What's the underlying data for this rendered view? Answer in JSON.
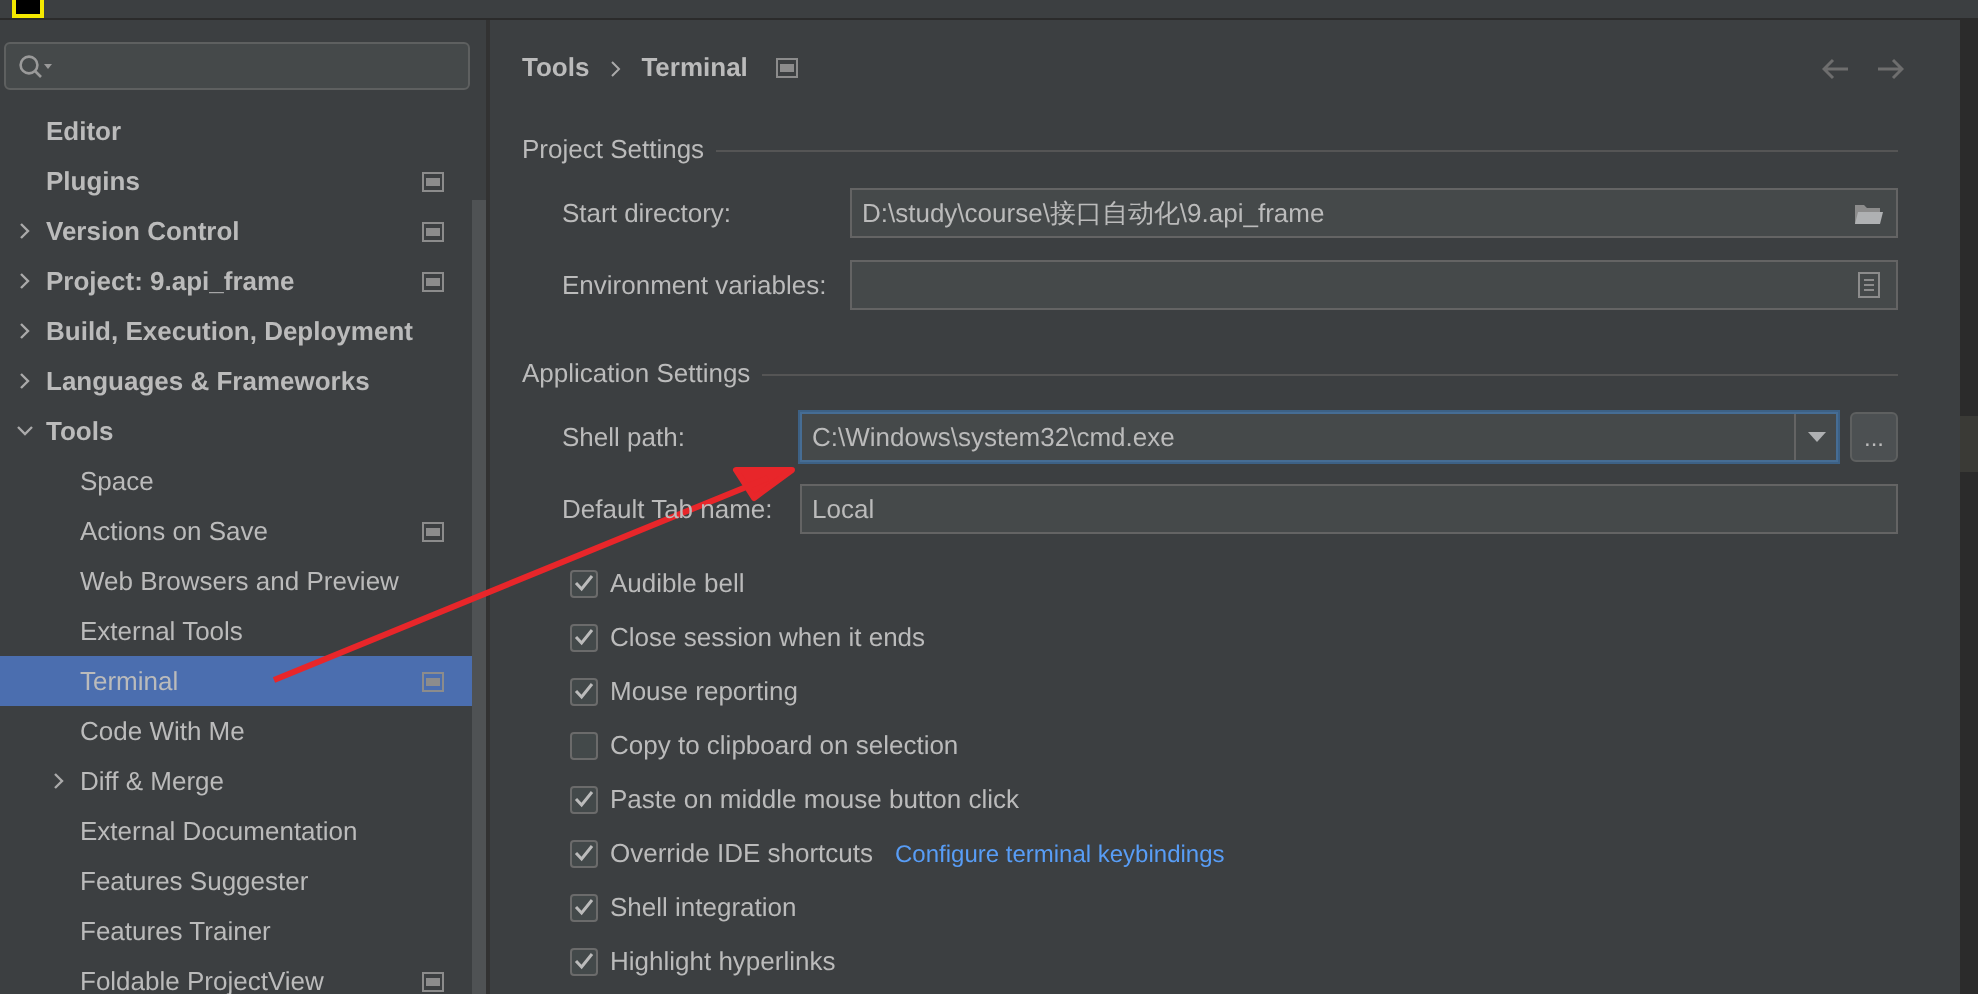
{
  "sidebar": {
    "items": [
      {
        "label": "Editor",
        "selected": false,
        "badge": false
      },
      {
        "label": "Plugins",
        "selected": false,
        "badge": true
      },
      {
        "label": "Version Control",
        "selected": false,
        "badge": true,
        "expanded": false
      },
      {
        "label": "Project: 9.api_frame",
        "selected": false,
        "badge": true,
        "expanded": false
      },
      {
        "label": "Build, Execution, Deployment",
        "selected": false,
        "badge": false,
        "expanded": false
      },
      {
        "label": "Languages & Frameworks",
        "selected": false,
        "badge": false,
        "expanded": false
      },
      {
        "label": "Tools",
        "selected": false,
        "badge": false,
        "expanded": true,
        "children": [
          {
            "label": "Space",
            "selected": false,
            "badge": false
          },
          {
            "label": "Actions on Save",
            "selected": false,
            "badge": true
          },
          {
            "label": "Web Browsers and Preview",
            "selected": false,
            "badge": false
          },
          {
            "label": "External Tools",
            "selected": false,
            "badge": false
          },
          {
            "label": "Terminal",
            "selected": true,
            "badge": true
          },
          {
            "label": "Code With Me",
            "selected": false,
            "badge": false
          },
          {
            "label": "Diff & Merge",
            "selected": false,
            "badge": false,
            "expanded": false
          },
          {
            "label": "External Documentation",
            "selected": false,
            "badge": false
          },
          {
            "label": "Features Suggester",
            "selected": false,
            "badge": false
          },
          {
            "label": "Features Trainer",
            "selected": false,
            "badge": false
          },
          {
            "label": "Foldable ProjectView",
            "selected": false,
            "badge": true
          }
        ]
      }
    ]
  },
  "breadcrumb": [
    "Tools",
    "Terminal"
  ],
  "sections": [
    {
      "title": "Project Settings",
      "fields": [
        {
          "label": "Start directory:",
          "value": "D:\\study\\course\\接口自动化\\9.api_frame",
          "kind": "folder",
          "focused": false
        },
        {
          "label": "Environment variables:",
          "kind": "list",
          "focused": false
        }
      ]
    },
    {
      "title": "Application Settings",
      "fields": [
        {
          "label": "Shell path:",
          "value": "C:\\Windows\\system32\\cmd.exe",
          "kind": "combo",
          "focused": true,
          "button": "..."
        },
        {
          "label": "Default Tab name:",
          "value": "Local",
          "kind": "text",
          "focused": false
        }
      ]
    }
  ],
  "options": [
    {
      "label": "Audible bell",
      "checked": true
    },
    {
      "label": "Close session when it ends",
      "checked": true
    },
    {
      "label": "Mouse reporting",
      "checked": true
    },
    {
      "label": "Copy to clipboard on selection",
      "checked": false
    },
    {
      "label": "Paste on middle mouse button click",
      "checked": true
    },
    {
      "label": "Override IDE shortcuts",
      "checked": true,
      "link": "Configure terminal keybindings"
    },
    {
      "label": "Shell integration",
      "checked": true
    },
    {
      "label": "Highlight hyperlinks",
      "checked": true
    }
  ]
}
